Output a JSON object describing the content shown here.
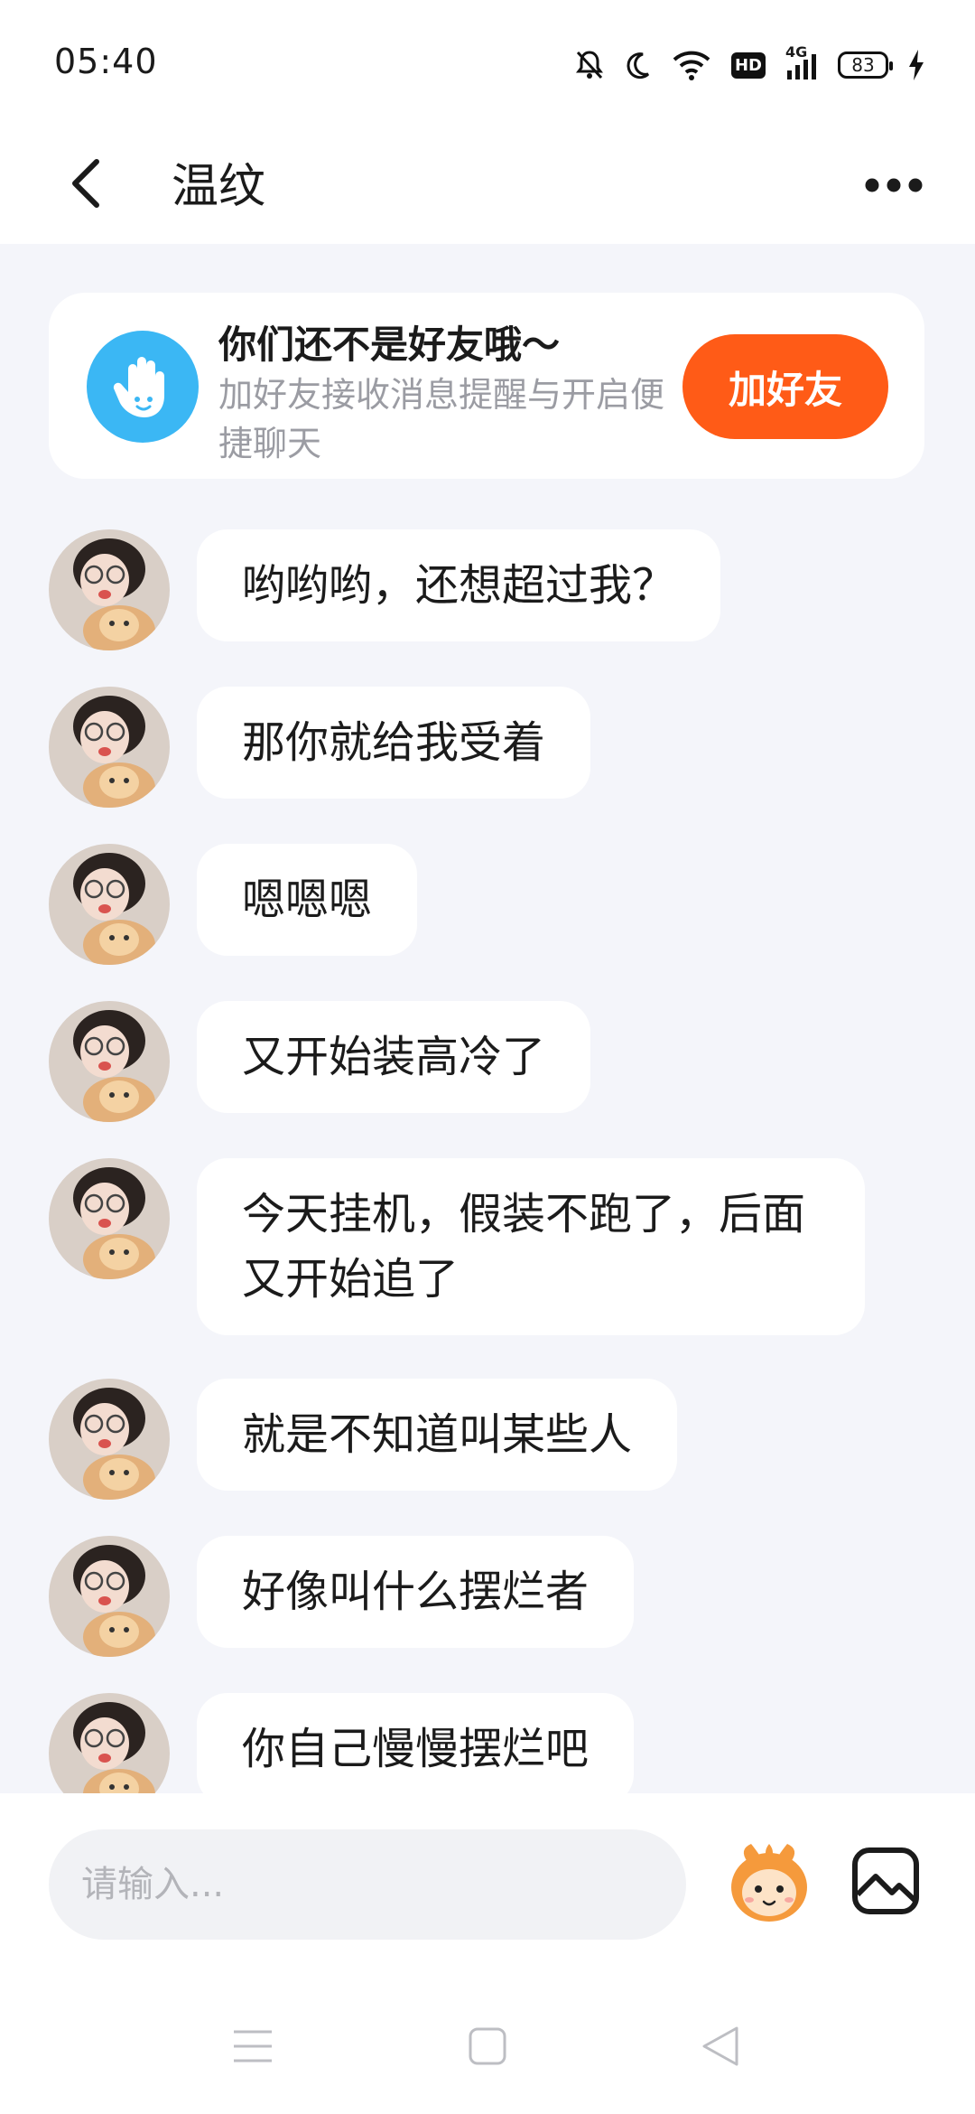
{
  "status_bar": {
    "time": "05:40",
    "battery": "83",
    "network": "4G",
    "hd": "HD"
  },
  "header": {
    "title": "温纹"
  },
  "friend_card": {
    "title": "你们还不是好友哦～",
    "description": "加好友接收消息提醒与开启便捷聊天",
    "button": "加好友"
  },
  "messages": [
    {
      "text": "哟哟哟，还想超过我？"
    },
    {
      "text": "那你就给我受着"
    },
    {
      "text": "嗯嗯嗯"
    },
    {
      "text": "又开始装高冷了"
    },
    {
      "text": "今天挂机，假装不跑了，后面又开始追了"
    },
    {
      "text": "就是不知道叫某些人"
    },
    {
      "text": "好像叫什么摆烂者"
    },
    {
      "text": "你自己慢慢摆烂吧"
    }
  ],
  "input": {
    "placeholder": "请输入..."
  },
  "colors": {
    "accent_orange": "#ff5b17",
    "hand_blue": "#3bb7f4",
    "chat_bg": "#f4f5fa"
  },
  "icons": [
    "back-arrow-icon",
    "more-dots-icon",
    "hand-wave-icon",
    "emoji-icon",
    "image-icon",
    "menu-icon",
    "home-icon",
    "back-triangle-icon"
  ]
}
